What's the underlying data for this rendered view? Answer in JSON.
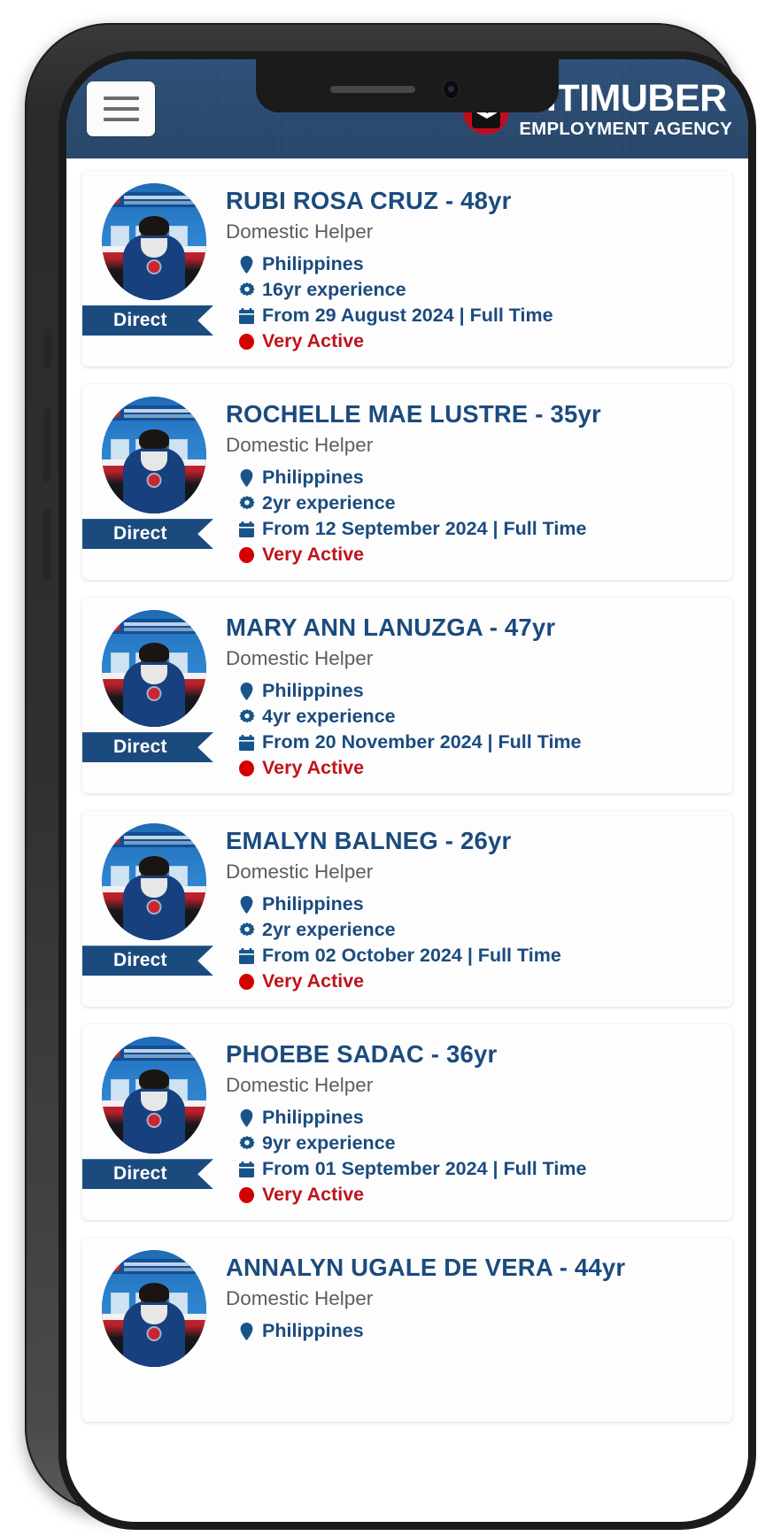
{
  "device": {
    "type": "smartphone-mockup",
    "notch": true
  },
  "header": {
    "menu_icon": "hamburger-menu-icon",
    "brand_name": "CITIMUBER",
    "brand_subtitle": "EMPLOYMENT AGENCY",
    "brand_logo_icon": "citimuber-hexagon-logo",
    "bg_color": "#2a4c74"
  },
  "colors": {
    "header_blue": "#2a4c74",
    "accent_blue": "#1b4b7e",
    "status_red": "#c0131c",
    "role_grey": "#5e5e5e",
    "ribbon_blue": "#1b4b7e",
    "card_bg": "#fdfdfd"
  },
  "icons": {
    "location": "map-pin-icon",
    "experience": "gear-icon",
    "availability": "calendar-icon",
    "status": "red-dot-icon"
  },
  "candidates": [
    {
      "name": "RUBI ROSA CRUZ - 48yr",
      "role": "Domestic Helper",
      "country": "Philippines",
      "experience": "16yr experience",
      "availability": "From 29 August 2024 | Full Time",
      "status": "Very Active",
      "badge": "Direct"
    },
    {
      "name": "ROCHELLE MAE LUSTRE - 35yr",
      "role": "Domestic Helper",
      "country": "Philippines",
      "experience": "2yr experience",
      "availability": "From 12 September 2024 | Full Time",
      "status": "Very Active",
      "badge": "Direct"
    },
    {
      "name": "MARY ANN LANUZGA - 47yr",
      "role": "Domestic Helper",
      "country": "Philippines",
      "experience": "4yr experience",
      "availability": "From 20 November 2024 | Full Time",
      "status": "Very Active",
      "badge": "Direct"
    },
    {
      "name": "EMALYN BALNEG - 26yr",
      "role": "Domestic Helper",
      "country": "Philippines",
      "experience": "2yr experience",
      "availability": "From 02 October 2024 | Full Time",
      "status": "Very Active",
      "badge": "Direct"
    },
    {
      "name": "PHOEBE SADAC - 36yr",
      "role": "Domestic Helper",
      "country": "Philippines",
      "experience": "9yr experience",
      "availability": "From 01 September 2024 | Full Time",
      "status": "Very Active",
      "badge": "Direct"
    },
    {
      "name": "ANNALYN UGALE DE VERA - 44yr",
      "role": "Domestic Helper",
      "country": "Philippines",
      "experience": "",
      "availability": "",
      "status": "",
      "badge": ""
    }
  ]
}
